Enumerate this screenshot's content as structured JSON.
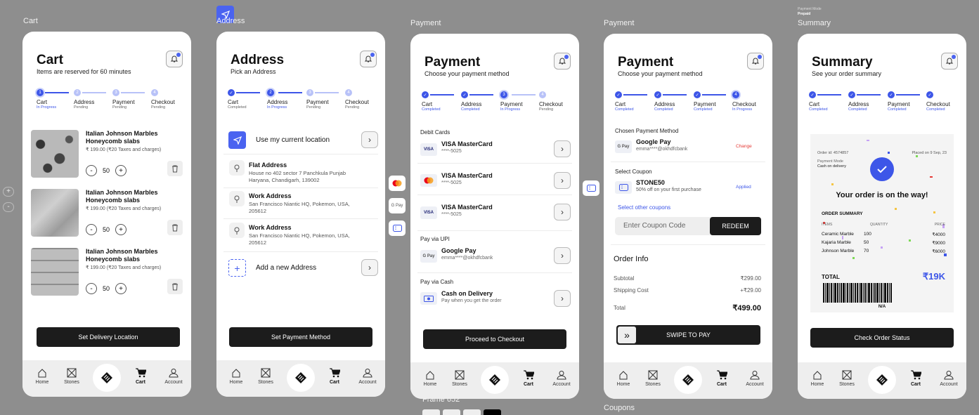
{
  "frames": {
    "cart": "Cart",
    "address": "Address",
    "payment1": "Payment",
    "payment2": "Payment",
    "summary": "Summary",
    "frame652": "Frame 652",
    "coupons": "Coupons",
    "pm_small_label": "Payment Mode",
    "pm_small_value": "Prepaid"
  },
  "zoom": {
    "in": "+",
    "out": "-"
  },
  "steps": {
    "cart": "Cart",
    "address": "Address",
    "payment": "Payment",
    "checkout": "Checkout",
    "in_progress": "In Progress",
    "pending": "Pending",
    "completed": "Completed"
  },
  "nav": {
    "home": "Home",
    "stones": "Stones",
    "cart": "Cart",
    "account": "Account"
  },
  "cart": {
    "title": "Cart",
    "subtitle": "Items are reserved for 60 minutes",
    "items": [
      {
        "name": "Italian Johnson Marbles Honeycomb slabs",
        "price": "₹ 199.00 (₹20 Taxes and charges)",
        "qty": "50"
      },
      {
        "name": "Italian Johnson Marbles Honeycomb slabs",
        "price": "₹ 199.00 (₹20 Taxes and charges)",
        "qty": "50"
      },
      {
        "name": "Italian Johnson Marbles Honeycomb slabs",
        "price": "₹ 199.00 (₹20 Taxes and charges)",
        "qty": "50"
      }
    ],
    "minus": "-",
    "plus": "+",
    "cta": "Set Delivery Location"
  },
  "address": {
    "title": "Address",
    "subtitle": "Pick an Address",
    "current": "Use my current location",
    "list": [
      {
        "title": "Flat Address",
        "detail": "House no 402 sector 7 Panchkula Punjab Haryana, Chandigarh, 139002"
      },
      {
        "title": "Work Address",
        "detail": "San Francisco Niantic HQ, Pokemon, USA, 205612"
      },
      {
        "title": "Work Address",
        "detail": "San Francisco Niantic HQ, Pokemon, USA, 205612"
      }
    ],
    "add": "Add a new Address",
    "cta": "Set Payment Method"
  },
  "payment": {
    "title": "Payment",
    "subtitle": "Choose your payment method",
    "debit_label": "Debit Cards",
    "cards": [
      {
        "logo": "VISA",
        "name": "VISA MasterCard",
        "num": "****-5025"
      },
      {
        "logo": "MC",
        "name": "VISA MasterCard",
        "num": "****-5025"
      },
      {
        "logo": "VISA",
        "name": "VISA MasterCard",
        "num": "****-5025"
      }
    ],
    "upi_label": "Pay via UPI",
    "upi_name": "Google Pay",
    "upi_id": "emma****@okhdfcbank",
    "upi_logo": "G Pay",
    "cash_label": "Pay via Cash",
    "cash_name": "Cash on Delivery",
    "cash_desc": "Pay when you get the order",
    "cta": "Proceed to Checkout"
  },
  "payment2": {
    "title": "Payment",
    "subtitle": "Choose your payment method",
    "chosen_label": "Chosen Payment Method",
    "method": "Google Pay",
    "method_id": "emma****@okhdfcbank",
    "change": "Change",
    "coupon_label": "Select Coupon",
    "coupon": "STONE50",
    "coupon_desc": "50% off on your first purchase",
    "applied": "Applied",
    "other": "Select other coupons",
    "coupon_placeholder": "Enter Coupon Code",
    "redeem": "REDEEM",
    "order_info": "Order Info",
    "subtotal_label": "Subtotal",
    "subtotal": "₹299.00",
    "ship_label": "Shipping Cost",
    "ship": "+₹29.00",
    "total_label": "Total",
    "total": "₹499.00",
    "swipe": "SWIPE TO PAY",
    "swipe_icon": "»"
  },
  "summary": {
    "title": "Summary",
    "subtitle": "See your order summary",
    "order_id": "Order id: 4574857",
    "placed": "Placed on 9 Sep, 23",
    "pm_label": "Payment Mode",
    "pm_value": "Cash on delivery",
    "headline": "Your order is on the way!",
    "os_title": "ORDER SUMMARY",
    "h_items": "ITEMS",
    "h_qty": "QUANTITY",
    "h_price": "PRICE",
    "rows": [
      {
        "item": "Ceramic Marble",
        "qty": "100",
        "price": "₹4000"
      },
      {
        "item": "Kajaria Marble",
        "qty": "50",
        "price": "₹9000"
      },
      {
        "item": "Johnson Marble",
        "qty": "70",
        "price": "₹6000"
      }
    ],
    "total_label": "TOTAL",
    "total": "₹19K",
    "na": "N/A",
    "cta": "Check Order Status"
  },
  "colors": {
    "accent": "#3d56e8",
    "dark": "#1c1c1c",
    "red": "#e53935"
  }
}
